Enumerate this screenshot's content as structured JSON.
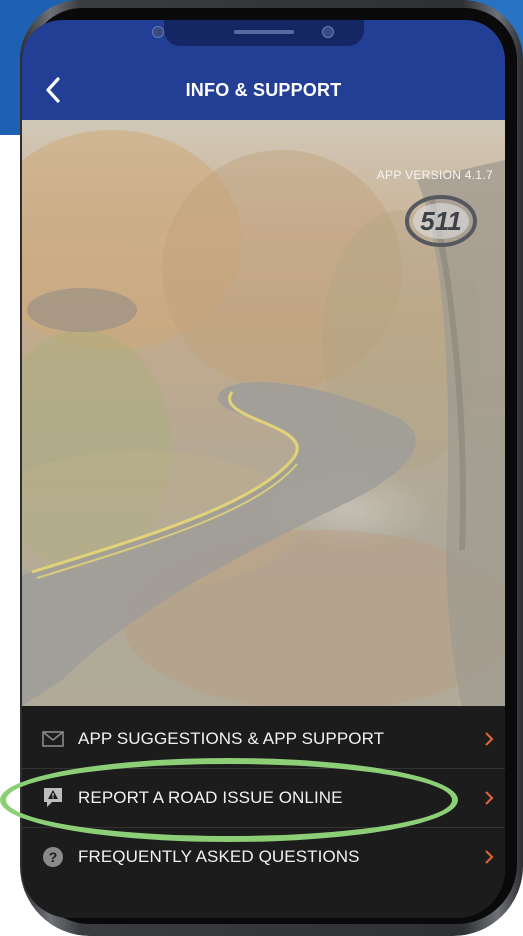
{
  "header": {
    "title": "INFO & SUPPORT",
    "back_icon": "chevron-left-icon"
  },
  "info": {
    "app_version": "APP VERSION 4.1.7",
    "logo_text": "511"
  },
  "menu": {
    "items": [
      {
        "label": "APP SUGGESTIONS & APP SUPPORT",
        "icon": "envelope-icon"
      },
      {
        "label": "REPORT A ROAD ISSUE ONLINE",
        "icon": "warning-icon"
      },
      {
        "label": "FREQUENTLY ASKED QUESTIONS",
        "icon": "question-icon"
      }
    ]
  },
  "colors": {
    "header": "#233f95",
    "accent_chevron": "#e2663a",
    "highlight": "#8ccf77",
    "menu_bg": "#1c1c1c"
  }
}
